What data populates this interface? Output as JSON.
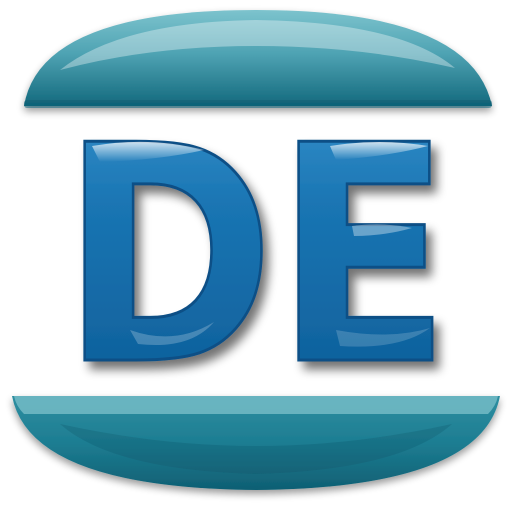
{
  "logo": {
    "text": "DE",
    "colors": {
      "background": "#ffffff",
      "primary_blue": "#1a75b3",
      "dark_blue": "#0b4f86",
      "teal_light": "#6fb8c3",
      "teal": "#2e8ea0",
      "teal_dark": "#13697d",
      "shadow": "#7a8a96",
      "highlight": "#ffffff"
    },
    "icon_name": "de-monogram-logo-icon"
  }
}
